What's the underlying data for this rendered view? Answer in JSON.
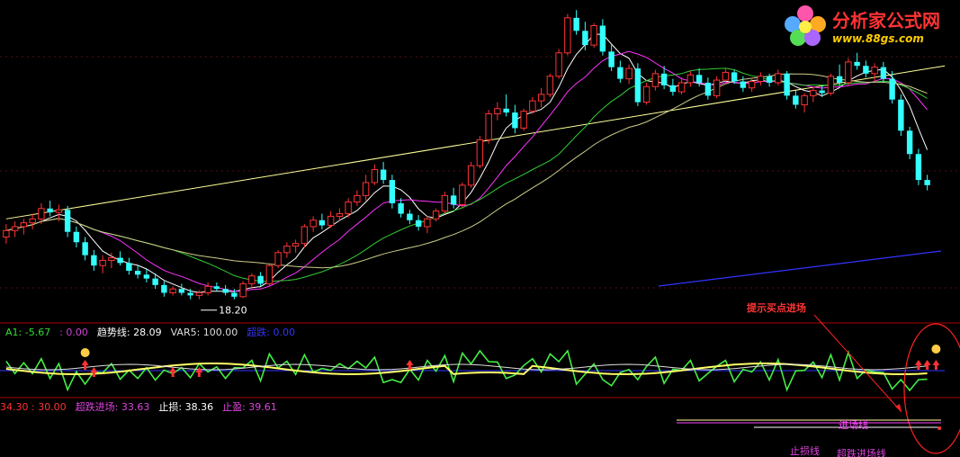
{
  "watermark": {
    "title": "分析家公式网",
    "url": "www.88gs.com"
  },
  "main_panel": {
    "low_label": "18.20"
  },
  "indicator_panel": {
    "items": [
      {
        "text": "A1: -5.67",
        "color": "#33dd33"
      },
      {
        "text": ": 0.00",
        "color": "#cc44cc"
      },
      {
        "text": "趋势线: 28.09",
        "color": "#ffffff"
      },
      {
        "text": "VAR5: 100.00",
        "color": "#dddddd"
      },
      {
        "text": "超跌: 0.00",
        "color": "#3333ff"
      }
    ],
    "annotation": "提示买点进场"
  },
  "lines_panel": {
    "items": [
      {
        "text": "34.30 : 30.00",
        "color": "#ff3333"
      },
      {
        "text": "超跌进场: 33.63",
        "color": "#dd44dd"
      },
      {
        "text": "止损: 38.36",
        "color": "#ffffff"
      },
      {
        "text": "止盈: 39.61",
        "color": "#dd44dd"
      }
    ],
    "line_labels": {
      "entry": "进场线",
      "stop": "止损线",
      "oversold": "超跌进场线"
    }
  },
  "colors": {
    "up": "#ff3333",
    "down": "#33ffff",
    "ma_white": "#ffffff",
    "ma_magenta": "#ff33ff",
    "ma_green": "#33cc33",
    "trend_yellow": "#ffff99",
    "ma_blue": "#3333ff",
    "separator": "#aa0000"
  },
  "chart_data": {
    "type": "candlestick",
    "candles": [
      [
        23.0,
        24.0,
        22.5,
        23.5
      ],
      [
        23.5,
        24.2,
        23.0,
        23.8
      ],
      [
        23.8,
        24.4,
        23.2,
        24.1
      ],
      [
        24.1,
        24.8,
        23.6,
        24.4
      ],
      [
        24.4,
        25.6,
        24.0,
        25.2
      ],
      [
        25.2,
        25.8,
        24.6,
        24.9
      ],
      [
        24.9,
        25.5,
        24.2,
        25.1
      ],
      [
        25.1,
        25.4,
        23.0,
        23.4
      ],
      [
        23.4,
        23.8,
        22.2,
        22.6
      ],
      [
        22.6,
        23.0,
        21.2,
        21.6
      ],
      [
        21.6,
        22.0,
        20.4,
        20.8
      ],
      [
        20.8,
        21.6,
        20.2,
        21.2
      ],
      [
        21.2,
        21.8,
        20.6,
        21.4
      ],
      [
        21.4,
        21.9,
        20.8,
        21.0
      ],
      [
        21.0,
        21.4,
        20.1,
        20.4
      ],
      [
        20.4,
        20.8,
        19.8,
        20.1
      ],
      [
        20.1,
        20.5,
        19.5,
        19.8
      ],
      [
        19.8,
        20.2,
        19.0,
        19.3
      ],
      [
        19.3,
        19.6,
        18.4,
        18.7
      ],
      [
        18.7,
        19.2,
        18.5,
        19.0
      ],
      [
        19.0,
        19.4,
        18.5,
        18.7
      ],
      [
        18.7,
        19.0,
        18.2,
        18.5
      ],
      [
        18.5,
        18.9,
        18.2,
        18.7
      ],
      [
        18.7,
        19.5,
        18.5,
        19.2
      ],
      [
        19.2,
        19.5,
        18.8,
        19.0
      ],
      [
        19.0,
        19.3,
        18.5,
        18.7
      ],
      [
        18.7,
        19.0,
        18.2,
        18.4
      ],
      [
        18.4,
        19.6,
        18.3,
        19.4
      ],
      [
        19.4,
        20.2,
        19.0,
        20.0
      ],
      [
        20.0,
        20.3,
        19.2,
        19.4
      ],
      [
        19.4,
        21.0,
        19.2,
        20.8
      ],
      [
        20.8,
        22.0,
        20.6,
        21.8
      ],
      [
        21.8,
        22.6,
        21.4,
        22.3
      ],
      [
        22.3,
        22.8,
        21.8,
        22.5
      ],
      [
        22.5,
        24.0,
        22.2,
        23.8
      ],
      [
        23.8,
        24.6,
        23.4,
        24.3
      ],
      [
        24.3,
        24.8,
        23.6,
        23.9
      ],
      [
        23.9,
        25.0,
        23.7,
        24.6
      ],
      [
        24.6,
        25.2,
        24.2,
        24.8
      ],
      [
        24.8,
        26.0,
        24.5,
        25.7
      ],
      [
        25.7,
        26.6,
        25.4,
        26.2
      ],
      [
        26.2,
        27.8,
        25.8,
        27.2
      ],
      [
        27.2,
        28.6,
        27.0,
        28.2
      ],
      [
        28.2,
        28.8,
        27.1,
        27.4
      ],
      [
        27.4,
        27.8,
        25.2,
        25.6
      ],
      [
        25.6,
        26.0,
        24.5,
        24.8
      ],
      [
        24.8,
        25.1,
        24.0,
        24.3
      ],
      [
        24.3,
        24.7,
        23.5,
        23.8
      ],
      [
        23.8,
        24.6,
        23.3,
        24.4
      ],
      [
        24.4,
        25.2,
        24.2,
        25.0
      ],
      [
        25.0,
        26.5,
        24.8,
        26.2
      ],
      [
        26.2,
        26.8,
        25.2,
        25.5
      ],
      [
        25.5,
        27.2,
        25.3,
        27.0
      ],
      [
        27.0,
        28.8,
        26.8,
        28.5
      ],
      [
        28.5,
        30.8,
        28.3,
        30.5
      ],
      [
        30.5,
        32.8,
        30.2,
        32.5
      ],
      [
        32.5,
        33.4,
        32.0,
        32.9
      ],
      [
        32.9,
        34.0,
        32.3,
        32.6
      ],
      [
        32.6,
        33.2,
        31.0,
        31.4
      ],
      [
        31.4,
        32.9,
        31.2,
        32.7
      ],
      [
        32.7,
        33.8,
        32.5,
        33.5
      ],
      [
        33.5,
        34.5,
        33.0,
        34.0
      ],
      [
        34.0,
        35.6,
        33.8,
        35.4
      ],
      [
        35.4,
        37.5,
        35.2,
        37.2
      ],
      [
        37.2,
        40.2,
        37.0,
        39.9
      ],
      [
        39.9,
        40.5,
        38.6,
        38.9
      ],
      [
        38.9,
        39.6,
        37.4,
        37.8
      ],
      [
        37.8,
        39.5,
        37.6,
        39.3
      ],
      [
        39.3,
        39.8,
        37.0,
        37.3
      ],
      [
        37.3,
        37.8,
        35.8,
        36.1
      ],
      [
        36.1,
        36.6,
        34.9,
        35.2
      ],
      [
        35.2,
        36.3,
        34.8,
        36.0
      ],
      [
        36.0,
        36.4,
        33.1,
        33.4
      ],
      [
        33.4,
        34.9,
        33.2,
        34.6
      ],
      [
        34.6,
        35.9,
        34.3,
        35.6
      ],
      [
        35.6,
        36.2,
        34.4,
        34.7
      ],
      [
        34.7,
        35.2,
        33.9,
        34.2
      ],
      [
        34.2,
        35.3,
        34.0,
        34.9
      ],
      [
        34.9,
        35.8,
        34.6,
        35.5
      ],
      [
        35.5,
        36.0,
        34.6,
        34.9
      ],
      [
        34.9,
        35.3,
        33.6,
        33.9
      ],
      [
        33.9,
        35.4,
        33.7,
        35.1
      ],
      [
        35.1,
        36.0,
        34.8,
        35.7
      ],
      [
        35.7,
        35.9,
        34.8,
        35.0
      ],
      [
        35.0,
        35.4,
        34.2,
        34.5
      ],
      [
        34.5,
        35.3,
        34.2,
        35.0
      ],
      [
        35.0,
        35.7,
        34.7,
        35.4
      ],
      [
        35.4,
        35.6,
        34.6,
        34.9
      ],
      [
        34.9,
        35.9,
        34.7,
        35.6
      ],
      [
        35.6,
        35.8,
        33.6,
        33.9
      ],
      [
        33.9,
        34.3,
        32.9,
        33.2
      ],
      [
        33.2,
        34.1,
        32.6,
        33.9
      ],
      [
        33.9,
        34.6,
        33.4,
        34.3
      ],
      [
        34.3,
        34.7,
        33.8,
        34.1
      ],
      [
        34.1,
        35.6,
        33.9,
        35.4
      ],
      [
        35.4,
        36.3,
        34.6,
        34.9
      ],
      [
        34.9,
        36.8,
        34.7,
        36.5
      ],
      [
        36.5,
        37.2,
        35.9,
        36.2
      ],
      [
        36.2,
        36.6,
        35.3,
        35.6
      ],
      [
        35.6,
        36.4,
        35.0,
        36.1
      ],
      [
        36.1,
        36.5,
        34.9,
        35.2
      ],
      [
        35.2,
        35.8,
        33.3,
        33.6
      ],
      [
        33.6,
        34.0,
        30.8,
        31.2
      ],
      [
        31.2,
        31.5,
        29.0,
        29.4
      ],
      [
        29.4,
        29.8,
        27.0,
        27.4
      ],
      [
        27.4,
        27.8,
        26.6,
        27.0
      ]
    ],
    "y_range": [
      17,
      41
    ],
    "trend_line": [
      [
        0,
        24.4
      ],
      [
        107,
        36.2
      ]
    ],
    "low_marker": {
      "index": 23,
      "value": 18.2
    }
  }
}
